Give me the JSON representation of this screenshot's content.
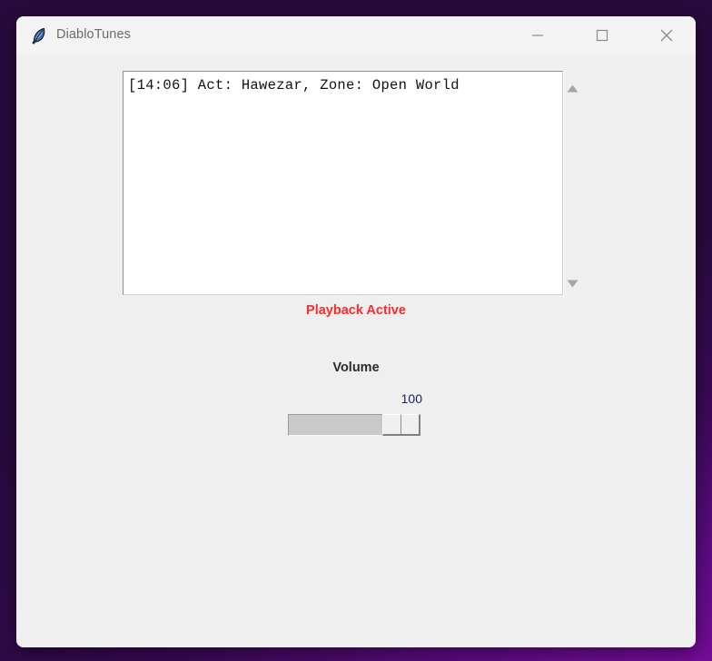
{
  "window": {
    "title": "DiabloTunes",
    "icon": "feather-icon",
    "controls": {
      "minimize": "minimize-icon",
      "maximize": "maximize-icon",
      "close": "close-icon"
    }
  },
  "log": {
    "lines": [
      "[14:06] Act: Hawezar, Zone: Open World"
    ],
    "line1": "[14:06] Act: Hawezar, Zone: Open World",
    "scrollbar": {
      "up_arrow": "scroll-up-icon",
      "down_arrow": "scroll-down-icon"
    }
  },
  "status": {
    "text": "Playback Active",
    "color": "#ff2a2a"
  },
  "volume": {
    "label": "Volume",
    "value": "100",
    "min": 0,
    "max": 100
  },
  "colors": {
    "desktop": "#2b0a3d",
    "window_bg": "#efefef",
    "titlebar": "#f3f3f3",
    "text_bg": "#ffffff",
    "status_red": "#ff2a2a",
    "trough": "#c9c9c9"
  }
}
